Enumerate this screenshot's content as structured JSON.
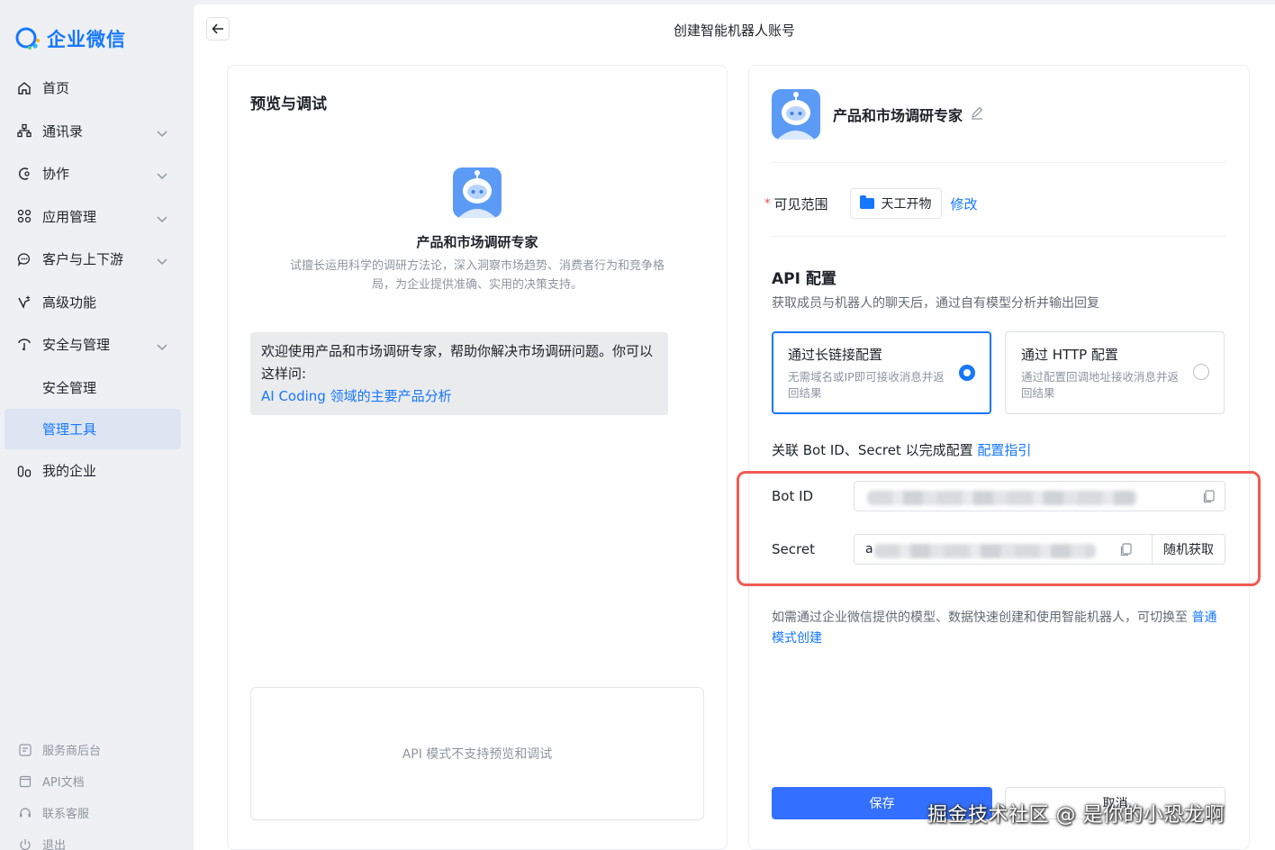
{
  "app": {
    "logo_text": "企业微信"
  },
  "sidebar": {
    "items": [
      {
        "label": "首页",
        "icon": "home-icon"
      },
      {
        "label": "通讯录",
        "icon": "org-chart-icon"
      },
      {
        "label": "协作",
        "icon": "collab-icon"
      },
      {
        "label": "应用管理",
        "icon": "apps-icon"
      },
      {
        "label": "客户与上下游",
        "icon": "chat-bubble-icon"
      },
      {
        "label": "高级功能",
        "icon": "sparkle-icon"
      },
      {
        "label": "安全与管理",
        "icon": "shield-icon"
      },
      {
        "label": "安全管理"
      },
      {
        "label": "管理工具"
      },
      {
        "label": "我的企业",
        "icon": "building-icon"
      }
    ],
    "footer": [
      {
        "label": "服务商后台",
        "icon": "console-icon"
      },
      {
        "label": "API文档",
        "icon": "doc-icon"
      },
      {
        "label": "联系客服",
        "icon": "headset-icon"
      },
      {
        "label": "退出",
        "icon": "power-icon"
      }
    ]
  },
  "header": {
    "title": "创建智能机器人账号"
  },
  "preview": {
    "title": "预览与调试",
    "bot_name": "产品和市场调研专家",
    "bot_desc": "试擅长运用科学的调研方法论，深入洞察市场趋势、消费者行为和竞争格局，为企业提供准确、实用的决策支持。",
    "welcome_text": "欢迎使用产品和市场调研专家，帮助你解决市场调研问题。你可以这样问:",
    "welcome_link": "AI Coding 领域的主要产品分析",
    "unsupported": "API 模式不支持预览和调试"
  },
  "config": {
    "bot_name": "产品和市场调研专家",
    "scope_label": "可见范围",
    "scope_required": "*",
    "scope_value": "天工开物",
    "scope_modify": "修改",
    "api_title": "API 配置",
    "api_sub": "获取成员与机器人的聊天后，通过自有模型分析并输出回复",
    "option_a": {
      "title": "通过长链接配置",
      "desc": "无需域名或IP即可接收消息并返回结果",
      "selected": true
    },
    "option_b": {
      "title": "通过 HTTP 配置",
      "desc": "通过配置回调地址接收消息并返回结果",
      "selected": false
    },
    "bind_text": "关联 Bot ID、Secret 以完成配置",
    "bind_link": "配置指引",
    "bot_id_label": "Bot ID",
    "secret_label": "Secret",
    "secret_prefix": "a",
    "random_btn": "随机获取",
    "note_text": "如需通过企业微信提供的模型、数据快速创建和使用智能机器人，可切换至",
    "note_link": "普通模式创建",
    "save": "保存",
    "cancel": "取消"
  },
  "watermark": "掘金技术社区 @ 是你的小恐龙啊",
  "colors": {
    "accent": "#1677ff",
    "save": "#3370ff",
    "highlight": "#f15b53"
  }
}
